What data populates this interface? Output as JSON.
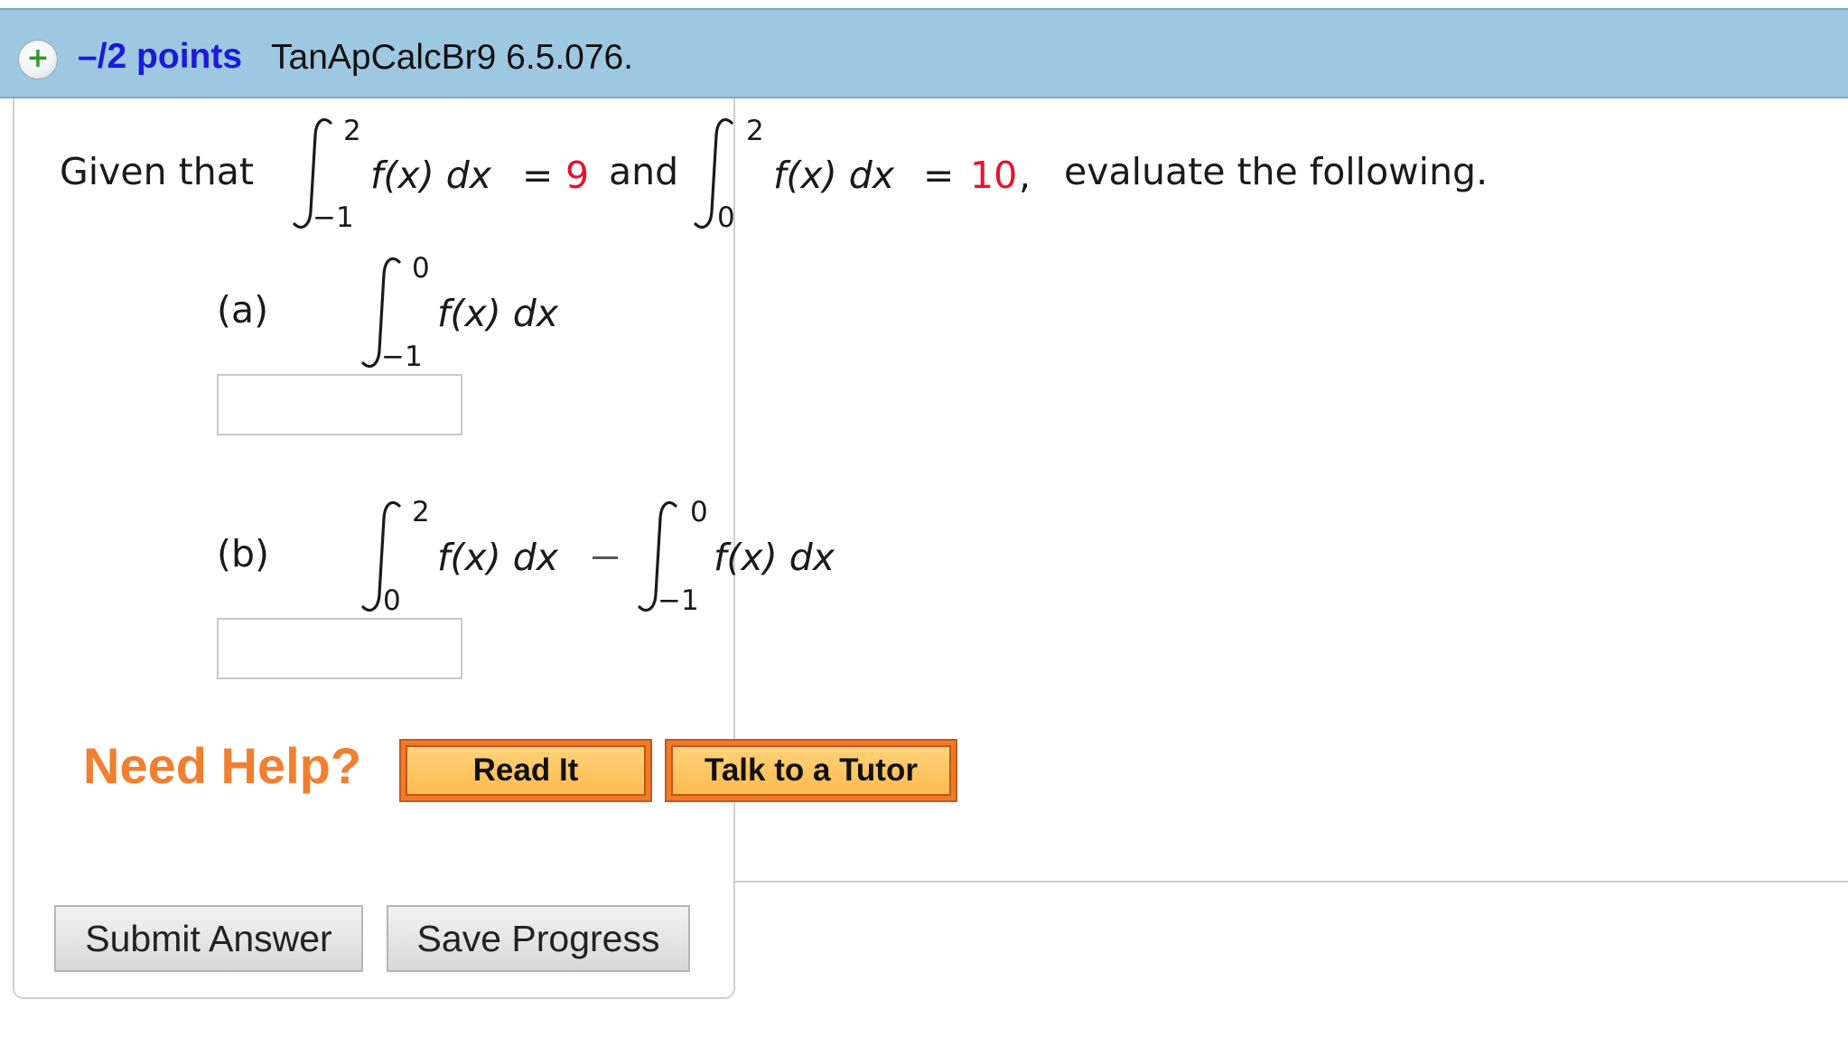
{
  "header": {
    "expand_icon": "plus-icon",
    "points": "–/2 points",
    "problem_id": "TanApCalcBr9 6.5.076."
  },
  "question": {
    "given_text": "Given that",
    "and_text": "and",
    "evaluate_text": "evaluate the following.",
    "integral_1": {
      "upper": "2",
      "lower": "−1",
      "integrand": "f(x) dx",
      "eq": "=",
      "value": "9"
    },
    "integral_2": {
      "upper": "2",
      "lower": "0",
      "integrand": "f(x) dx",
      "eq": "=",
      "value": "10",
      "comma": ","
    }
  },
  "parts": [
    {
      "label": "(a)",
      "integral": {
        "upper": "0",
        "lower": "−1",
        "integrand": "f(x) dx"
      },
      "answer_value": ""
    },
    {
      "label": "(b)",
      "integral_left": {
        "upper": "2",
        "lower": "0",
        "integrand": "f(x) dx"
      },
      "operator": "minus",
      "integral_right": {
        "upper": "0",
        "lower": "−1",
        "integrand": "f(x) dx"
      },
      "answer_value": ""
    }
  ],
  "help": {
    "title": "Need Help?",
    "read_it": "Read It",
    "talk_to_tutor": "Talk to a Tutor"
  },
  "actions": {
    "submit": "Submit Answer",
    "save": "Save Progress"
  },
  "colors": {
    "header_bg": "#9ec8e2",
    "points": "#1a1adb",
    "value_red": "#e8112d",
    "help_orange": "#f07f2f",
    "button_orange": "#ffbb4f"
  }
}
